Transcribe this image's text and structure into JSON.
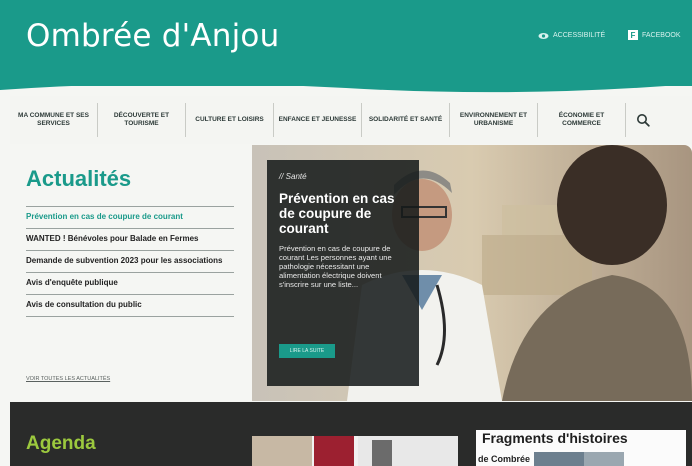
{
  "header": {
    "site_title": "Ombrée d'Anjou",
    "accessibility_label": "ACCESSIBILITÉ",
    "facebook_label": "FACEBOOK",
    "brand_color": "#1a9a8a"
  },
  "nav": {
    "items": [
      {
        "label": "MA COMMUNE ET SES SERVICES"
      },
      {
        "label": "DÉCOUVERTE ET TOURISME"
      },
      {
        "label": "CULTURE ET LOISIRS"
      },
      {
        "label": "ENFANCE ET JEUNESSE"
      },
      {
        "label": "SOLIDARITÉ ET SANTÉ"
      },
      {
        "label": "ENVIRONNEMENT ET URBANISME"
      },
      {
        "label": "ÉCONOMIE ET COMMERCE"
      }
    ],
    "search_icon": "search-icon"
  },
  "news": {
    "title": "Actualités",
    "items": [
      {
        "label": "Prévention en cas de coupure de courant"
      },
      {
        "label": "WANTED ! Bénévoles pour Balade en Fermes"
      },
      {
        "label": "Demande de subvention 2023 pour les associations"
      },
      {
        "label": "Avis d'enquête publique"
      },
      {
        "label": "Avis de consultation du public"
      }
    ],
    "all_link": "VOIR TOUTES LES ACTUALITÉS"
  },
  "hero": {
    "category": "// Santé",
    "title": "Prévention en cas de coupure de courant",
    "text": "Prévention en cas de coupure de courant Les personnes ayant une pathologie nécessitant une alimentation électrique doivent s'inscrire sur une liste...",
    "button": "LIRE LA SUITE"
  },
  "agenda": {
    "title": "Agenda",
    "accent_color": "#9cc93e",
    "fragments_title": "Fragments d'histoires",
    "fragments_subtitle": "de Combrée"
  }
}
